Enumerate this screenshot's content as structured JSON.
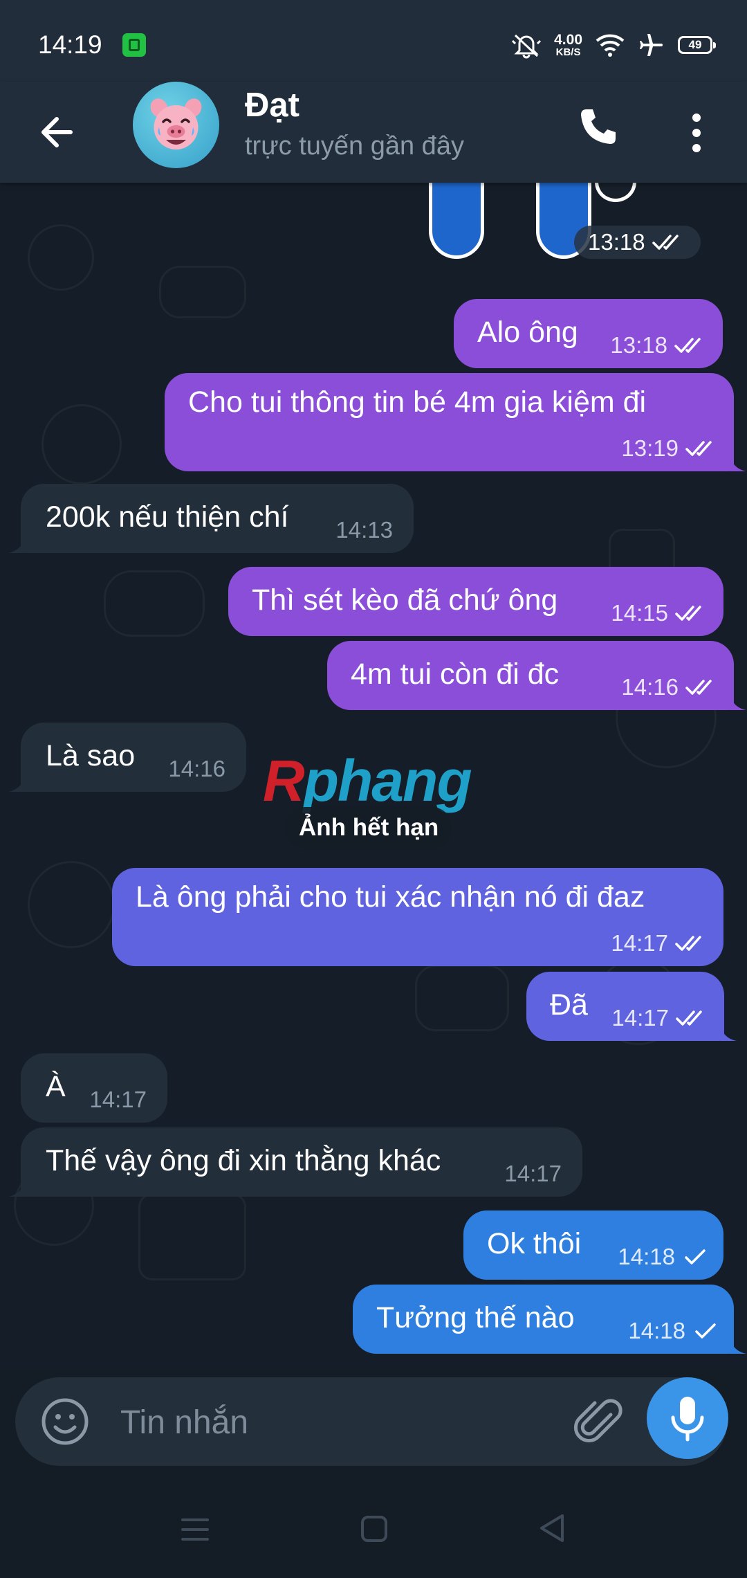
{
  "status_bar": {
    "time": "14:19",
    "speed_value": "4.00",
    "speed_unit": "KB/S",
    "battery": "49"
  },
  "header": {
    "contact_name": "Đạt",
    "contact_status": "trực tuyến gần đây"
  },
  "sticker": {
    "time": "13:18"
  },
  "messages": [
    {
      "dir": "out",
      "text": "Alo ông",
      "time": "13:18"
    },
    {
      "dir": "out",
      "text": "Cho tui thông tin bé 4m gia kiệm đi",
      "time": "13:19"
    },
    {
      "dir": "in",
      "text": "200k nếu thiện chí",
      "time": "14:13"
    },
    {
      "dir": "out",
      "text": "Thì sét kèo đã chứ ông",
      "time": "14:15"
    },
    {
      "dir": "out",
      "text": "4m tui còn đi đc",
      "time": "14:16"
    },
    {
      "dir": "in",
      "text": "Là sao",
      "time": "14:16"
    },
    {
      "dir": "out",
      "text": "Là ông phải cho tui xác nhận nó đi đaz",
      "time": "14:17"
    },
    {
      "dir": "out",
      "text": "Đã",
      "time": "14:17"
    },
    {
      "dir": "in",
      "text": "À",
      "time": "14:17"
    },
    {
      "dir": "in",
      "text": "Thế vậy ông đi xin thằng khác",
      "time": "14:17"
    },
    {
      "dir": "out",
      "text": "Ok thôi",
      "time": "14:18"
    },
    {
      "dir": "out",
      "text": "Tưởng thế nào",
      "time": "14:18"
    }
  ],
  "expired_photo_label": "Ảnh hết hạn",
  "watermark": {
    "first": "R",
    "rest": "phang"
  },
  "composer": {
    "placeholder": "Tin nhắn"
  },
  "colors": {
    "bubble_purple": "#8a4ed8",
    "bubble_indigo": "#5f63e0",
    "bubble_blue": "#2e7fe0",
    "bubble_incoming": "#222e3a",
    "accent": "#3a95e8"
  }
}
